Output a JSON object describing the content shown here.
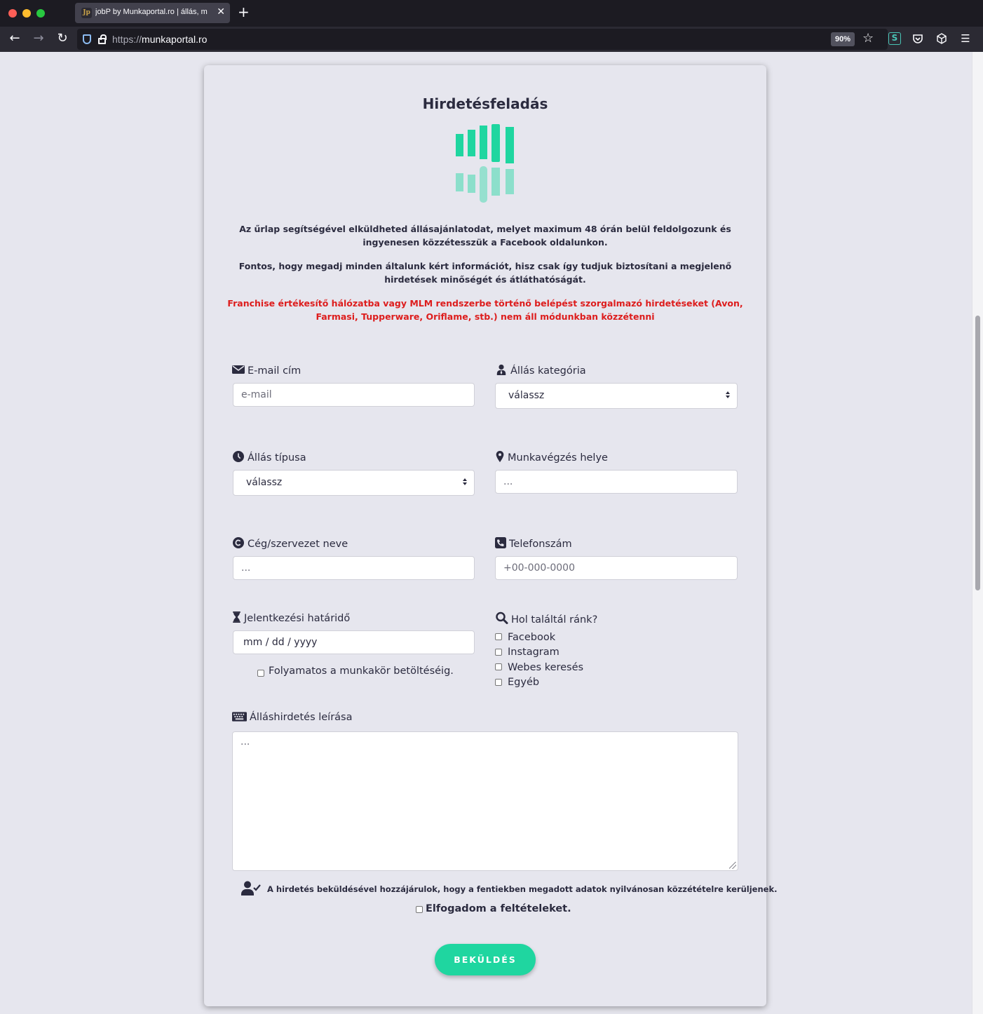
{
  "browser": {
    "tab_title": "jobP by Munkaportal.ro | állás, m",
    "tab_favicon": "Jp",
    "tab_close": "✕",
    "new_tab": "+",
    "back": "←",
    "forward": "→",
    "reload": "↻",
    "url_protocol": "https://",
    "url_host": "munkaportal.ro",
    "zoom": "90%",
    "star": "☆",
    "menu": "☰"
  },
  "form": {
    "title": "Hirdetésfeladás",
    "intro_1": "Az űrlap segítségével elküldheted állásajánlatodat, melyet maximum 48 órán belül feldolgozunk és ingyenesen közzétesszük a Facebook oldalunkon.",
    "intro_2": "Fontos, hogy megadj minden általunk kért információt, hisz csak így tudjuk biztosítani a megjelenő hirdetések minőségét és átláthatóságát.",
    "warning": "Franchise értékesítő hálózatba vagy MLM rendszerbe történő belépést szorgalmazó hirdetéseket (Avon, Farmasi, Tupperware, Oriflame, stb.) nem áll módunkban közzétenni",
    "email": {
      "label": "E-mail cím",
      "placeholder": "e-mail"
    },
    "category": {
      "label": "Állás kategória",
      "value": "válassz"
    },
    "job_type": {
      "label": "Állás típusa",
      "value": "válassz"
    },
    "location": {
      "label": "Munkavégzés helye",
      "placeholder": "..."
    },
    "company": {
      "label": "Cég/szervezet neve",
      "placeholder": "..."
    },
    "phone": {
      "label": "Telefonszám",
      "placeholder": "+00-000-0000"
    },
    "deadline": {
      "label": "Jelentkezési határidő",
      "placeholder": "mm / dd / yyyy",
      "ongoing_label": "Folyamatos a munkakör betöltéséig."
    },
    "source": {
      "label": "Hol találtál ránk?",
      "options": [
        "Facebook",
        "Instagram",
        "Webes keresés",
        "Egyéb"
      ]
    },
    "description": {
      "label": "Álláshirdetés leírása",
      "placeholder": "..."
    },
    "consent_text": "A hirdetés beküldésével hozzájárulok, hogy a fentiekben megadott adatok nyilvánosan közzétételre kerüljenek.",
    "accept_label": "Elfogadom a feltételeket.",
    "submit_label": "BEKÜLDÉS"
  },
  "colors": {
    "accent": "#1fd6a0",
    "warning": "#dd1d1d",
    "text": "#2b2b3f",
    "background": "#e6e6ee"
  },
  "icons": {
    "email": "envelope-icon",
    "category": "user-tie-icon",
    "job_type": "clock-icon",
    "location": "map-marker-icon",
    "company": "copyright-icon",
    "phone": "phone-icon",
    "deadline": "hourglass-icon",
    "source": "search-icon",
    "description": "keyboard-icon",
    "consent": "user-check-icon"
  }
}
